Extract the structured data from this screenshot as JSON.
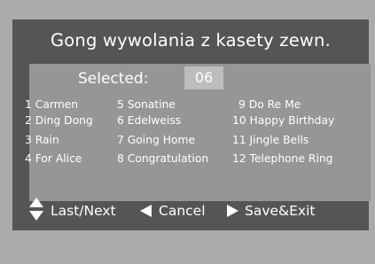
{
  "title": "Gong wywolania z kasety zewn.",
  "selected": {
    "label": "Selected:",
    "value": "06"
  },
  "melodies": [
    "1 Carmen",
    "2 Ding Dong",
    "3 Rain",
    "4 For Alice",
    "5 Sonatine",
    "6 Edelweiss",
    "7 Going Home",
    "8 Congratulation",
    "9 Do Re Me",
    "10 Happy Birthday",
    "11 Jingle Bells",
    "12 Telephone Ring"
  ],
  "footer": {
    "nav_label": "Last/Next",
    "cancel_label": "Cancel",
    "save_label": "Save&Exit"
  },
  "icons": {
    "nav": "up-down-arrows-icon",
    "cancel": "left-triangle-icon",
    "save": "right-triangle-icon"
  },
  "colors": {
    "screen": "#555556",
    "panel": "#969696",
    "selected_box": "#bdbdbd",
    "text": "#ffffff"
  }
}
